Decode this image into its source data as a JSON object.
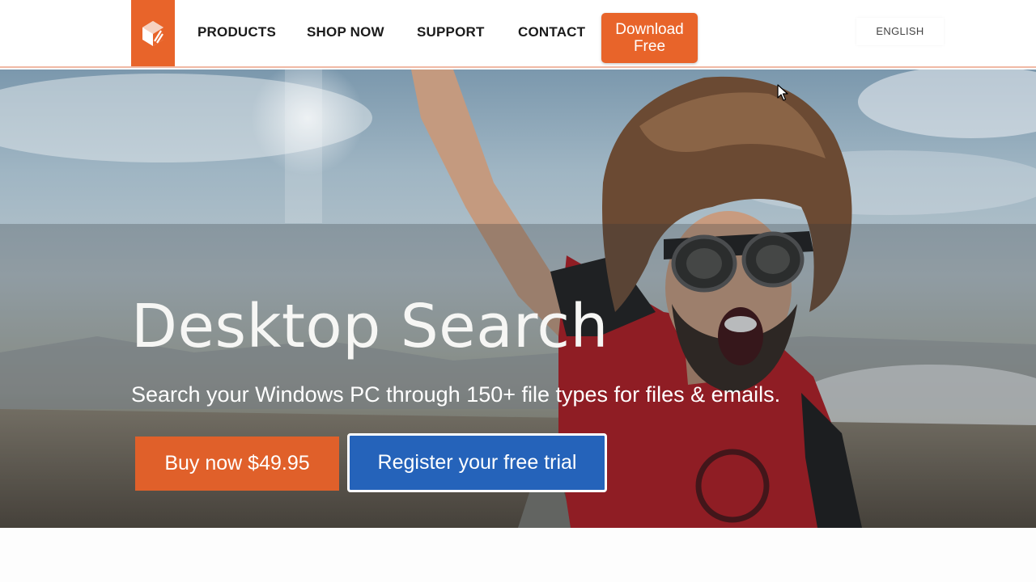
{
  "header": {
    "logo": {
      "icon": "cube-logo-icon",
      "color": "#e8642a"
    },
    "nav": [
      {
        "label": "PRODUCTS"
      },
      {
        "label": "SHOP NOW"
      },
      {
        "label": "SUPPORT"
      },
      {
        "label": "CONTACT"
      }
    ],
    "download_button": {
      "line1": "Download",
      "line2": "Free"
    },
    "language": "ENGLISH"
  },
  "hero": {
    "title": "Desktop Search",
    "subtitle": "Search your Windows PC through 150+ file types for files & emails.",
    "buy_button": "Buy now $49.95",
    "trial_button": "Register your free trial"
  },
  "colors": {
    "accent": "#e8642a",
    "primary_blue": "#2563ba"
  }
}
